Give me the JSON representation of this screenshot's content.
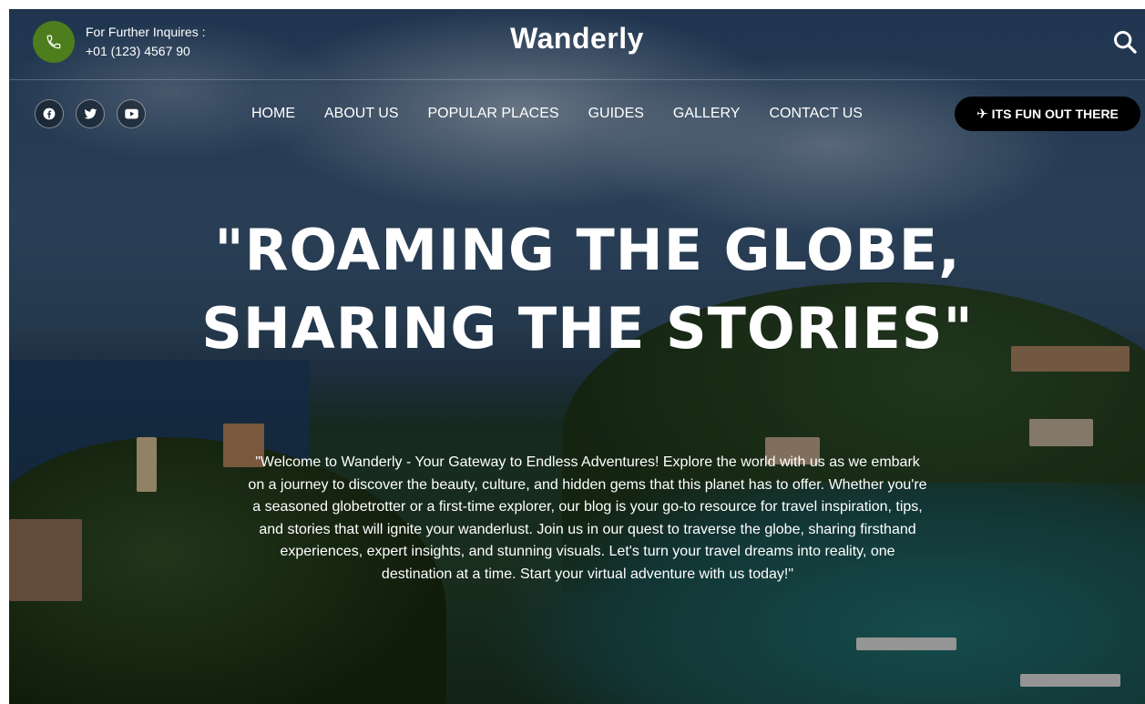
{
  "header": {
    "inquiry_label": "For Further Inquires :",
    "phone": "+01 (123) 4567 90",
    "brand": "Wanderly"
  },
  "icons": {
    "phone": "phone-icon",
    "search": "search-icon",
    "social": [
      "facebook-icon",
      "twitter-icon",
      "youtube-icon"
    ],
    "cta": "airplane-icon"
  },
  "nav": {
    "items": [
      "HOME",
      "ABOUT US",
      "POPULAR PLACES",
      "GUIDES",
      "GALLERY",
      "CONTACT US"
    ]
  },
  "cta": {
    "label": "ITS FUN OUT THERE",
    "icon_glyph": "✈"
  },
  "hero": {
    "headline": "\"ROAMING THE GLOBE, SHARING THE STORIES\"",
    "intro": "\"Welcome to Wanderly - Your Gateway to Endless Adventures! Explore the world with us as we embark on a journey to discover the beauty, culture, and hidden gems that this planet has to offer. Whether you're a seasoned globetrotter or a first-time explorer, our blog is your go-to resource for travel inspiration, tips, and stories that will ignite your wanderlust. Join us in our quest to traverse the globe, sharing firsthand experiences, expert insights, and stunning visuals. Let's turn your travel dreams into reality, one destination at a time. Start your virtual adventure with us today!\""
  },
  "colors": {
    "phone_badge": "#4e7d1e",
    "cta_background": "#000000",
    "text": "#ffffff"
  }
}
